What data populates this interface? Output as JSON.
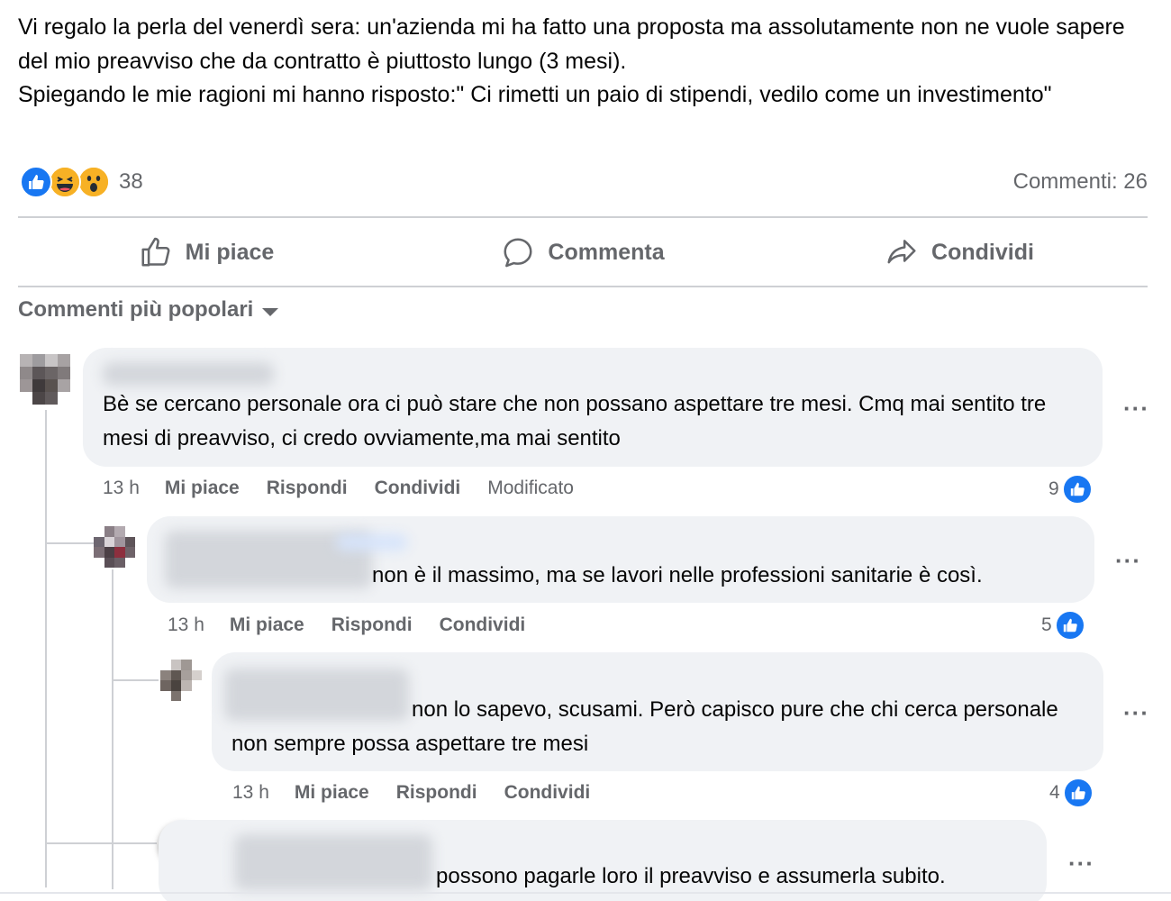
{
  "post": {
    "text_line1": "Vi regalo la perla del venerdì sera: un'azienda mi ha fatto una proposta ma assolutamente non ne vuole sapere del mio preavviso che da contratto è piuttosto lungo (3 mesi).",
    "text_line2": "Spiegando le mie ragioni mi hanno risposto:\" Ci rimetti un paio di stipendi, vedilo come un investimento\"",
    "reaction_count": "38",
    "comments_count": "Commenti: 26",
    "reactions": [
      "like-icon",
      "haha-icon",
      "wow-icon"
    ]
  },
  "actions": {
    "like": "Mi piace",
    "comment": "Commenta",
    "share": "Condividi"
  },
  "sort": {
    "label": "Commenti più popolari"
  },
  "comments": [
    {
      "text": "Bè se cercano personale ora ci può stare che non possano aspettare tre mesi. Cmq mai sentito tre mesi di preavviso, ci credo ovviamente,ma mai sentito",
      "time": "13 h",
      "like": "Mi piace",
      "reply": "Rispondi",
      "share": "Condividi",
      "edited": "Modificato",
      "likes": "9"
    },
    {
      "text": "non è il massimo, ma se lavori nelle professioni sanitarie è così.",
      "time": "13 h",
      "like": "Mi piace",
      "reply": "Rispondi",
      "share": "Condividi",
      "likes": "5"
    },
    {
      "text": "non lo sapevo, scusami. Però capisco pure che chi cerca personale non sempre possa aspettare tre mesi",
      "time": "13 h",
      "like": "Mi piace",
      "reply": "Rispondi",
      "share": "Condividi",
      "likes": "4"
    },
    {
      "text": "possono pagarle loro il preavviso e assumerla subito."
    }
  ],
  "colors": {
    "accent": "#1877f2",
    "secondary_text": "#65676b",
    "bubble": "#f0f2f5",
    "divider": "#ced0d4"
  }
}
